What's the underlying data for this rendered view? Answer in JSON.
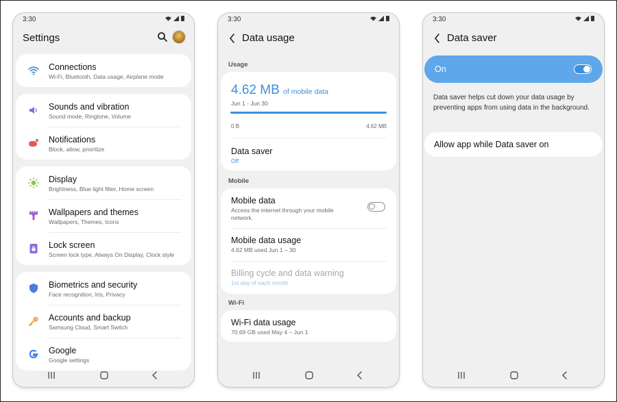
{
  "phone1": {
    "status_time": "3:30",
    "title": "Settings",
    "groups": [
      [
        {
          "title": "Connections",
          "subtitle": "Wi-Fi, Bluetooth, Data usage, Airplane mode",
          "icon": "wifi-icon",
          "color": "#4a90d9"
        }
      ],
      [
        {
          "title": "Sounds and vibration",
          "subtitle": "Sound mode, Ringtone, Volume",
          "icon": "volume-icon",
          "color": "#7b6fd8"
        },
        {
          "title": "Notifications",
          "subtitle": "Block, allow, prioritize",
          "icon": "notification-icon",
          "color": "#e25a52"
        }
      ],
      [
        {
          "title": "Display",
          "subtitle": "Brightness, Blue light filter, Home screen",
          "icon": "brightness-icon",
          "color": "#8bc34a"
        },
        {
          "title": "Wallpapers and themes",
          "subtitle": "Wallpapers, Themes, Icons",
          "icon": "brush-icon",
          "color": "#a35bd1"
        },
        {
          "title": "Lock screen",
          "subtitle": "Screen lock type, Always On Display, Clock style",
          "icon": "lock-icon",
          "color": "#8e6ad8"
        }
      ],
      [
        {
          "title": "Biometrics and security",
          "subtitle": "Face recognition, Iris, Privacy",
          "icon": "shield-icon",
          "color": "#4d7cdb"
        },
        {
          "title": "Accounts and backup",
          "subtitle": "Samsung Cloud, Smart Switch",
          "icon": "key-icon",
          "color": "#f0a23a"
        },
        {
          "title": "Google",
          "subtitle": "Google settings",
          "icon": "google-icon",
          "color": "#4285f4"
        }
      ]
    ]
  },
  "phone2": {
    "status_time": "3:30",
    "title": "Data usage",
    "usage_section": "Usage",
    "usage_amount": "4.62 MB",
    "usage_suffix": "of mobile data",
    "usage_range": "Jun 1 - Jun 30",
    "usage_min": "0 B",
    "usage_max": "4.62 MB",
    "usage_fraction": 1.0,
    "data_saver_title": "Data saver",
    "data_saver_status": "Off",
    "mobile_section": "Mobile",
    "mobile_data_title": "Mobile data",
    "mobile_data_subtitle_1": "Access the internet through your mobile",
    "mobile_data_subtitle_2": "network.",
    "mobile_usage_title": "Mobile data usage",
    "mobile_usage_subtitle": "4.62 MB used Jun 1 – 30",
    "billing_title": "Billing cycle and data warning",
    "billing_subtitle": "1st day of each month",
    "wifi_section": "Wi-Fi",
    "wifi_usage_title": "Wi-Fi data usage",
    "wifi_usage_subtitle": "70.69 GB used May 4 – Jun 1"
  },
  "phone3": {
    "status_time": "3:30",
    "title": "Data saver",
    "on_label": "On",
    "description": "Data saver helps cut down your data usage by preventing apps from using data in the background.",
    "allow_label": "Allow app while Data saver on"
  },
  "colors": {
    "accent": "#3d8ed8",
    "on_card": "#5ea7ea",
    "background": "#f0f0f0"
  }
}
